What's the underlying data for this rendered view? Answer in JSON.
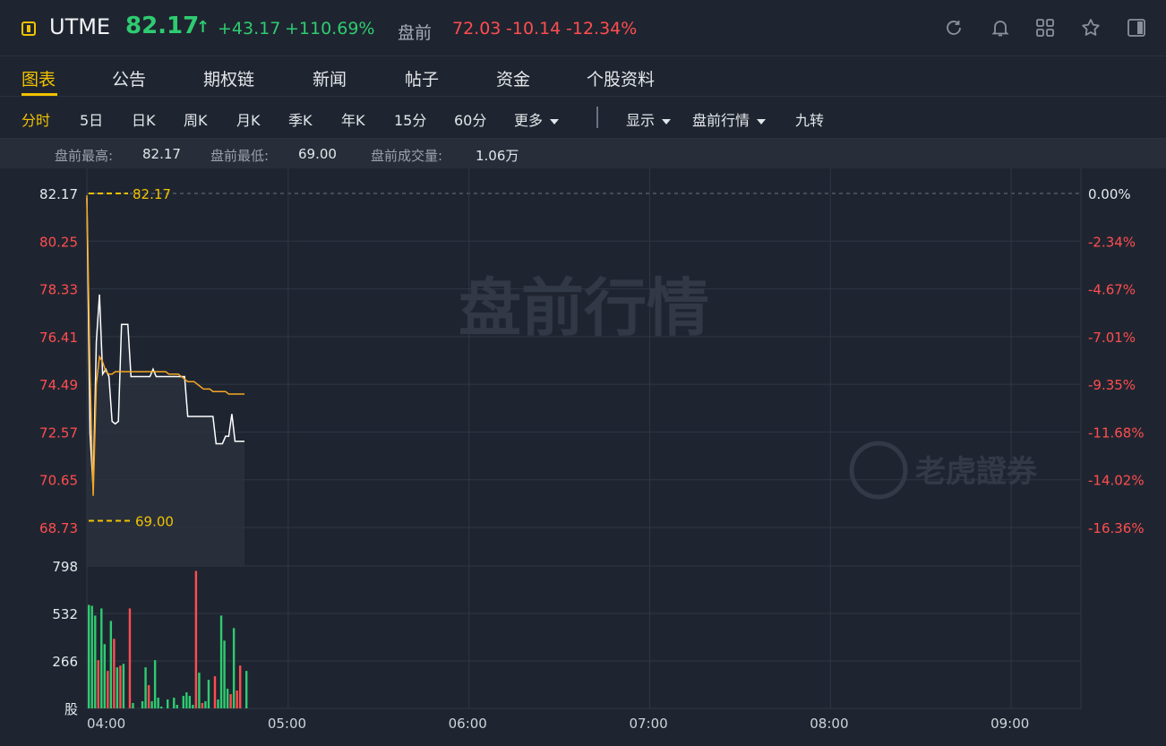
{
  "header": {
    "ticker": "UTME",
    "price": "82.17",
    "price_arrow": "↑",
    "change": "+43.17",
    "change_pct": "+110.69%",
    "premarket_label": "盘前",
    "premarket_price": "72.03",
    "premarket_change": "-10.14",
    "premarket_change_pct": "-12.34%",
    "icons": [
      "refresh-icon",
      "bell-icon",
      "grid-icon",
      "star-icon",
      "sidebar-icon"
    ]
  },
  "tabs": [
    {
      "label": "图表",
      "active": true
    },
    {
      "label": "公告"
    },
    {
      "label": "期权链"
    },
    {
      "label": "新闻"
    },
    {
      "label": "帖子"
    },
    {
      "label": "资金"
    },
    {
      "label": "个股资料"
    }
  ],
  "periods": [
    {
      "label": "分时",
      "active": true
    },
    {
      "label": "5日"
    },
    {
      "label": "日K"
    },
    {
      "label": "周K"
    },
    {
      "label": "月K"
    },
    {
      "label": "季K"
    },
    {
      "label": "年K"
    },
    {
      "label": "15分"
    },
    {
      "label": "60分"
    },
    {
      "label": "更多",
      "dropdown": true
    },
    {
      "label": "显示",
      "dropdown": true
    },
    {
      "label": "盘前行情",
      "dropdown": true
    },
    {
      "label": "九转"
    }
  ],
  "stats": {
    "high_label": "盘前最高:",
    "high_value": "82.17",
    "low_label": "盘前最低:",
    "low_value": "69.00",
    "volume_label": "盘前成交量:",
    "volume_value": "1.06万"
  },
  "chart_data": {
    "type": "line",
    "watermark": "盘前行情",
    "brand_watermark": "老虎證券",
    "x_ticks": [
      "04:00",
      "05:00",
      "06:00",
      "07:00",
      "08:00",
      "09:00"
    ],
    "price_ticks": [
      "82.17",
      "80.25",
      "78.33",
      "76.41",
      "74.49",
      "72.57",
      "70.65",
      "68.73"
    ],
    "pct_ticks": [
      "0.00%",
      "-2.34%",
      "-4.67%",
      "-7.01%",
      "-9.35%",
      "-11.68%",
      "-14.02%",
      "-16.36%"
    ],
    "ylim": [
      68.73,
      82.17
    ],
    "high_marker": "82.17",
    "low_marker": "69.00",
    "volume_ticks": [
      "798",
      "532",
      "266",
      "股"
    ],
    "volume_max": 798,
    "series": [
      {
        "color": "#ffffff",
        "x": [
          0,
          1,
          2,
          3,
          4,
          5,
          6,
          7,
          8,
          9,
          10,
          11,
          12,
          13,
          14,
          15,
          16,
          17,
          18,
          19,
          20,
          21,
          22,
          23,
          24,
          25,
          26,
          27,
          28,
          29,
          30,
          31,
          32,
          33,
          34,
          35,
          36,
          37,
          38,
          39,
          40,
          41,
          42,
          43,
          44,
          45,
          46,
          47,
          48,
          49,
          50
        ],
        "values": [
          82.0,
          72.5,
          70.3,
          76.2,
          78.1,
          74.9,
          75.1,
          74.8,
          73.0,
          72.9,
          73.0,
          76.9,
          76.9,
          76.9,
          74.8,
          74.8,
          74.8,
          74.8,
          74.8,
          74.8,
          74.8,
          75.1,
          74.8,
          74.8,
          74.8,
          74.8,
          74.8,
          74.8,
          74.8,
          74.8,
          74.8,
          74.8,
          73.2,
          73.2,
          73.2,
          73.2,
          73.2,
          73.2,
          73.2,
          73.2,
          73.2,
          72.1,
          72.1,
          72.1,
          72.4,
          72.4,
          73.3,
          72.2,
          72.2,
          72.2,
          72.2
        ]
      },
      {
        "color": "#f5a623",
        "x": [
          0,
          1,
          2,
          3,
          4,
          5,
          6,
          7,
          8,
          9,
          10,
          11,
          12,
          13,
          14,
          15,
          16,
          17,
          18,
          19,
          20,
          21,
          22,
          23,
          24,
          25,
          26,
          27,
          28,
          29,
          30,
          31,
          32,
          33,
          34,
          35,
          36,
          37,
          38,
          39,
          40,
          41,
          42,
          43,
          44,
          45,
          46,
          47,
          48,
          49,
          50
        ],
        "values": [
          82.1,
          75.0,
          70.0,
          74.5,
          75.6,
          75.4,
          75.0,
          74.9,
          74.9,
          75.0,
          75.0,
          75.0,
          75.0,
          75.0,
          75.0,
          75.0,
          75.0,
          75.0,
          75.0,
          75.0,
          75.0,
          75.0,
          75.0,
          75.0,
          75.0,
          75.0,
          74.9,
          74.9,
          74.9,
          74.9,
          74.8,
          74.7,
          74.6,
          74.6,
          74.6,
          74.5,
          74.4,
          74.3,
          74.3,
          74.3,
          74.2,
          74.2,
          74.2,
          74.2,
          74.2,
          74.1,
          74.1,
          74.1,
          74.1,
          74.1,
          74.1
        ]
      }
    ],
    "volume": {
      "x": [
        0,
        1,
        2,
        3,
        4,
        5,
        6,
        7,
        8,
        9,
        10,
        11,
        12,
        13,
        14,
        15,
        16,
        17,
        18,
        19,
        20,
        21,
        22,
        23,
        24,
        25,
        26,
        27,
        28,
        29,
        30,
        31,
        32,
        33,
        34,
        35,
        36,
        37,
        38,
        39,
        40,
        41,
        42,
        43,
        44,
        45,
        46,
        47,
        48,
        49,
        50
      ],
      "values": [
        580,
        575,
        520,
        270,
        560,
        360,
        210,
        490,
        390,
        230,
        240,
        250,
        0,
        560,
        30,
        0,
        0,
        40,
        230,
        130,
        40,
        270,
        60,
        10,
        0,
        50,
        0,
        60,
        20,
        0,
        70,
        90,
        70,
        20,
        770,
        200,
        30,
        40,
        160,
        0,
        180,
        50,
        520,
        380,
        110,
        80,
        450,
        100,
        240,
        0,
        210
      ],
      "colors": [
        "g",
        "g",
        "g",
        "r",
        "g",
        "g",
        "r",
        "g",
        "r",
        "g",
        "r",
        "g",
        "g",
        "r",
        "g",
        "g",
        "g",
        "g",
        "g",
        "r",
        "g",
        "g",
        "g",
        "g",
        "g",
        "g",
        "g",
        "g",
        "g",
        "g",
        "g",
        "g",
        "g",
        "g",
        "r",
        "g",
        "r",
        "g",
        "g",
        "g",
        "r",
        "g",
        "g",
        "g",
        "g",
        "r",
        "g",
        "r",
        "r",
        "g",
        "g"
      ]
    }
  }
}
